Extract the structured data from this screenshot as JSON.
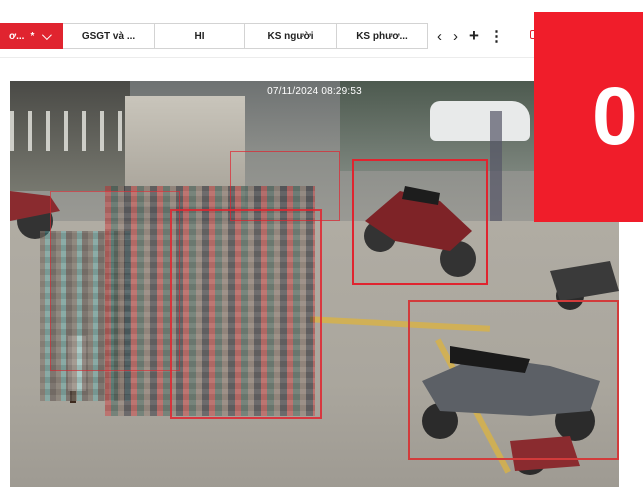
{
  "tabs": [
    {
      "label": "ơ...",
      "marker": "*",
      "active": true
    },
    {
      "label": "GSGT và ...",
      "active": false
    },
    {
      "label": "HI",
      "active": false
    },
    {
      "label": "KS người",
      "active": false
    },
    {
      "label": "KS phươ...",
      "active": false
    }
  ],
  "nav": {
    "prev": "‹",
    "next": "›",
    "add": "+",
    "more": "⋮"
  },
  "camera": {
    "timestamp": "07/11/2024 08:29:53"
  },
  "overlay": {
    "partial_text": "0"
  },
  "colors": {
    "accent": "#e0242f",
    "panel": "#f01d2a"
  }
}
